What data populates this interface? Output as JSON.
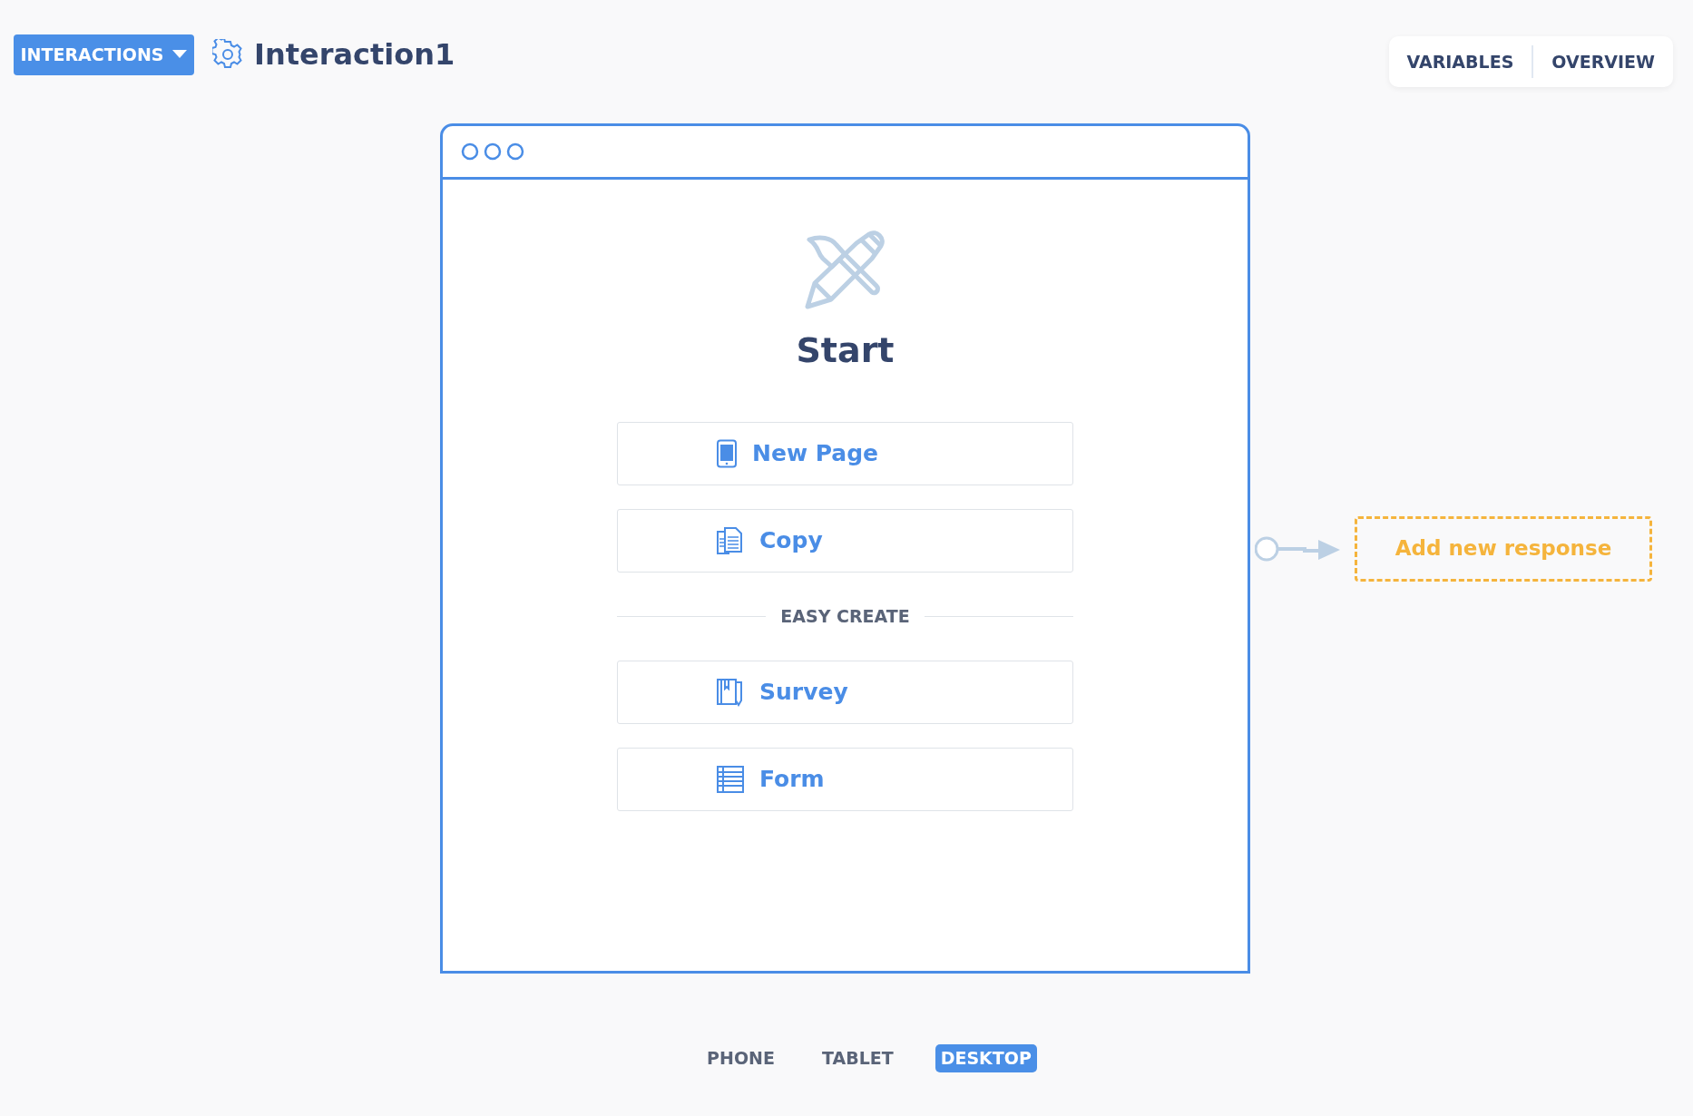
{
  "header": {
    "menu_button": "INTERACTIONS",
    "title": "Interaction1",
    "tabs": [
      {
        "label": "VARIABLES"
      },
      {
        "label": "OVERVIEW"
      }
    ]
  },
  "canvas": {
    "screen": {
      "title": "Start",
      "actions": [
        {
          "label": "New Page",
          "kind": "page"
        },
        {
          "label": "Copy",
          "kind": "copy"
        }
      ],
      "section_label": "EASY CREATE",
      "templates": [
        {
          "label": "Survey",
          "kind": "survey"
        },
        {
          "label": "Form",
          "kind": "form"
        }
      ]
    },
    "response_button": "Add new response"
  },
  "device_tabs": [
    {
      "label": "PHONE",
      "selected": false
    },
    {
      "label": "TABLET",
      "selected": false
    },
    {
      "label": "DESKTOP",
      "selected": true
    }
  ]
}
